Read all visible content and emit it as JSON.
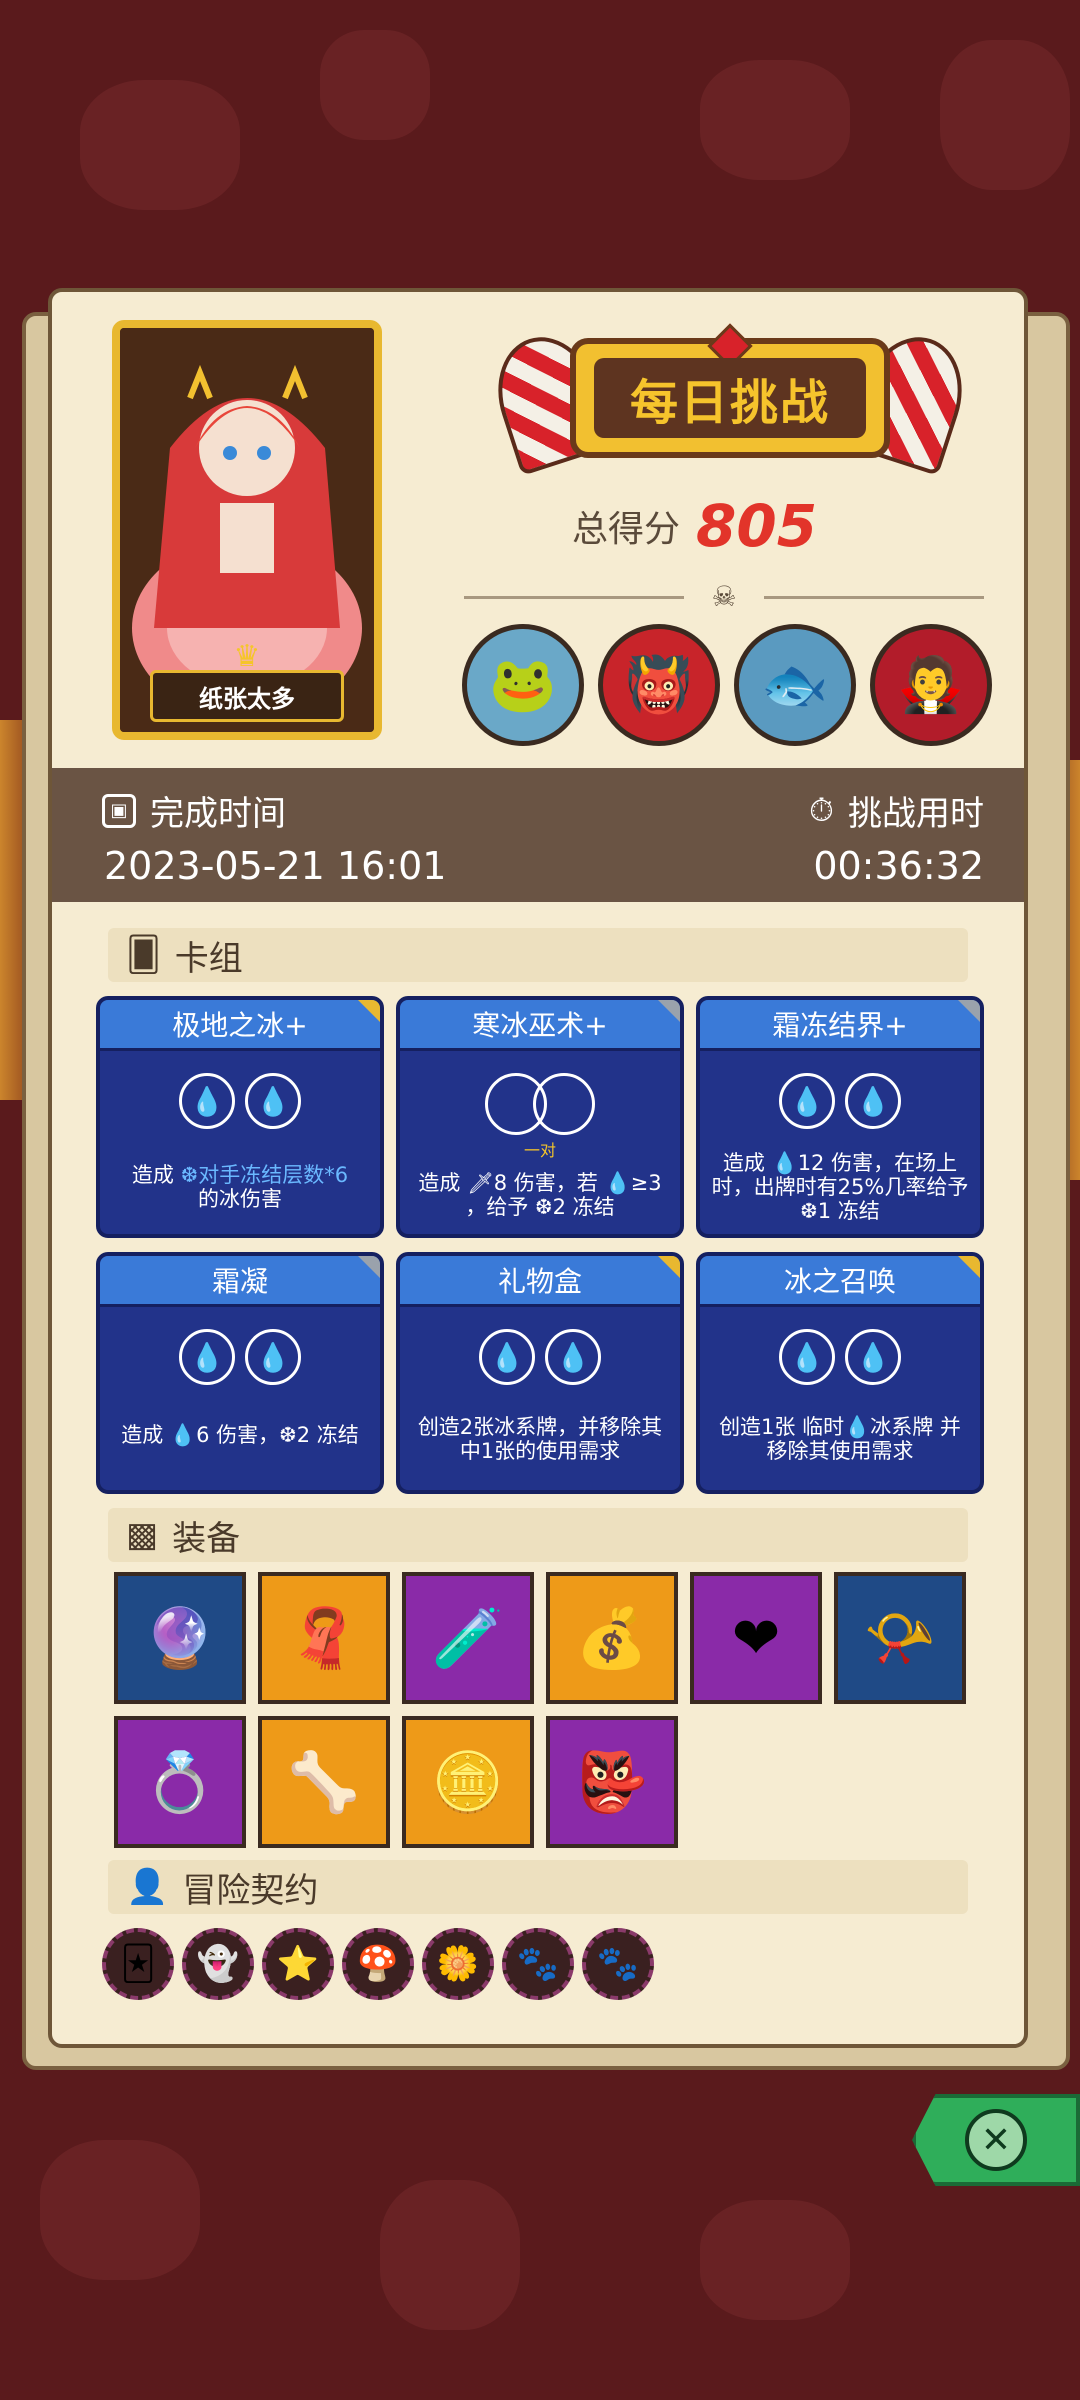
{
  "header": {
    "character_name": "纸张太多",
    "challenge_title": "每日挑战",
    "score_label": "总得分",
    "score_value": "805"
  },
  "bosses": [
    {
      "icon": "frog-monster-icon",
      "color": "#6aa8c8"
    },
    {
      "icon": "cage-monster-icon",
      "color": "#c8242a"
    },
    {
      "icon": "fish-monster-icon",
      "color": "#5a9ac0"
    },
    {
      "icon": "vampire-monster-icon",
      "color": "#b21c2a"
    }
  ],
  "time_info": {
    "completion_label": "完成时间",
    "completion_value": "2023-05-21 16:01",
    "duration_label": "挑战用时",
    "duration_value": "00:36:32"
  },
  "deck": {
    "label": "卡组",
    "cards": [
      {
        "name": "极地之冰+",
        "desc": "造成 ❆对手冻结层数*6 的冰伤害",
        "desc_line1": "造成 ",
        "desc_hi": "❆对手冻结层数*6",
        "desc_line2": "的冰伤害",
        "pair": ""
      },
      {
        "name": "寒冰巫术+",
        "desc": "造成 🗡8 伤害，若 💧≥3 ，给予 ❆2 冻结",
        "pair": "一对"
      },
      {
        "name": "霜冻结界+",
        "desc": "造成 💧12 伤害，在场上时，出牌时有25%几率给予 ❆1 冻结",
        "pair": ""
      },
      {
        "name": "霜凝",
        "desc": "造成 💧6 伤害，❆2 冻结",
        "pair": ""
      },
      {
        "name": "礼物盒",
        "desc": "创造2张冰系牌，并移除其中1张的使用需求",
        "pair": ""
      },
      {
        "name": "冰之召唤",
        "desc": "创造1张 临时💧冰系牌 并移除其使用需求",
        "pair": ""
      }
    ]
  },
  "equipment": {
    "label": "装备",
    "items": [
      {
        "icon": "pink-crystal-icon",
        "bg": "blue"
      },
      {
        "icon": "purple-scarf-icon",
        "bg": "orange"
      },
      {
        "icon": "purple-potion-icon",
        "bg": "purple"
      },
      {
        "icon": "gold-sack-icon",
        "bg": "orange"
      },
      {
        "icon": "heart-shield-icon",
        "bg": "purple"
      },
      {
        "icon": "horn-cup-icon",
        "bg": "blue"
      },
      {
        "icon": "ice-ring-icon",
        "bg": "purple"
      },
      {
        "icon": "ice-horn-icon",
        "bg": "orange"
      },
      {
        "icon": "gold-coin-ring-icon",
        "bg": "orange"
      },
      {
        "icon": "ice-mask-icon",
        "bg": "purple"
      }
    ]
  },
  "contracts": {
    "label": "冒险契约",
    "items": [
      "card-icon",
      "ghost-icon",
      "star-icon",
      "mushroom-icon",
      "flower-icon",
      "paw-icon",
      "paw-icon"
    ]
  },
  "colors": {
    "score": "#e2342a",
    "card_bg": "#22338a",
    "card_title": "#3a7ad8",
    "panel": "#f6ecd2",
    "close": "#2fae5a"
  }
}
